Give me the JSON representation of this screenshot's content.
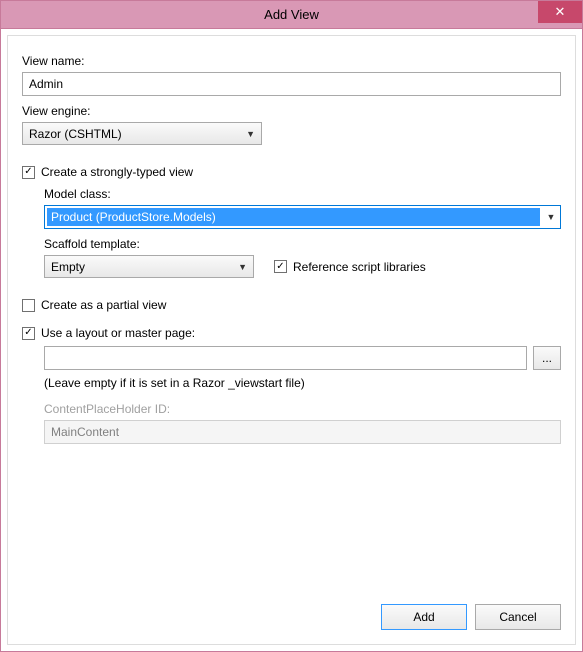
{
  "window": {
    "title": "Add View"
  },
  "labels": {
    "viewName": "View name:",
    "viewEngine": "View engine:",
    "modelClass": "Model class:",
    "scaffoldTemplate": "Scaffold template:",
    "contentPlaceholder": "ContentPlaceHolder ID:"
  },
  "fields": {
    "viewName": "Admin",
    "viewEngine": "Razor (CSHTML)",
    "modelClass": "Product (ProductStore.Models)",
    "scaffoldTemplate": "Empty",
    "layoutPath": "",
    "contentPlaceholderId": "MainContent"
  },
  "checks": {
    "stronglyTyped": {
      "label": "Create a strongly-typed view",
      "checked": true
    },
    "refScripts": {
      "label": "Reference script libraries",
      "checked": true
    },
    "partialView": {
      "label": "Create as a partial view",
      "checked": false
    },
    "useLayout": {
      "label": "Use a layout or master page:",
      "checked": true
    }
  },
  "hint": "(Leave empty if it is set in a Razor _viewstart file)",
  "buttons": {
    "browse": "...",
    "add": "Add",
    "cancel": "Cancel",
    "close": "✕"
  }
}
